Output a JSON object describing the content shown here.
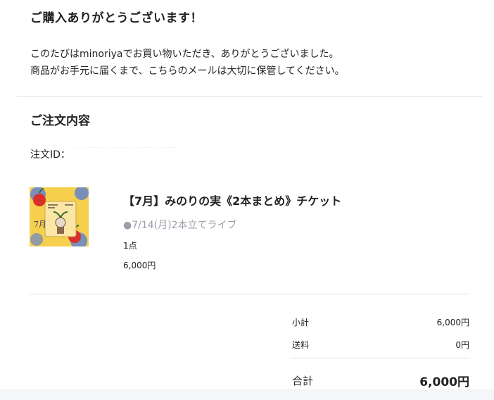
{
  "header": {
    "title": "ご購入ありがとうございます！",
    "intro_line1": "このたびはminoriyaでお買い物いただき、ありがとうございました。",
    "intro_line2": "商品がお手元に届くまで、こちらのメールは大切に保管してください。"
  },
  "order": {
    "section_title": "ご注文内容",
    "id_label": "注文ID："
  },
  "item": {
    "thumbnail_icon": "product-ticket-thumbnail",
    "name": "【7月】みのりの実《2本まとめ》チケット",
    "option": "●7/14(月)2本立てライブ",
    "quantity": "1点",
    "price": "6,000円"
  },
  "summary": {
    "subtotal_label": "小計",
    "subtotal_value": "6,000円",
    "shipping_label": "送料",
    "shipping_value": "0円",
    "total_label": "合計",
    "total_value": "6,000円"
  },
  "colors": {
    "background": "#f5f6fa",
    "card": "#ffffff",
    "text": "#222222",
    "muted": "#9aa0aa"
  }
}
